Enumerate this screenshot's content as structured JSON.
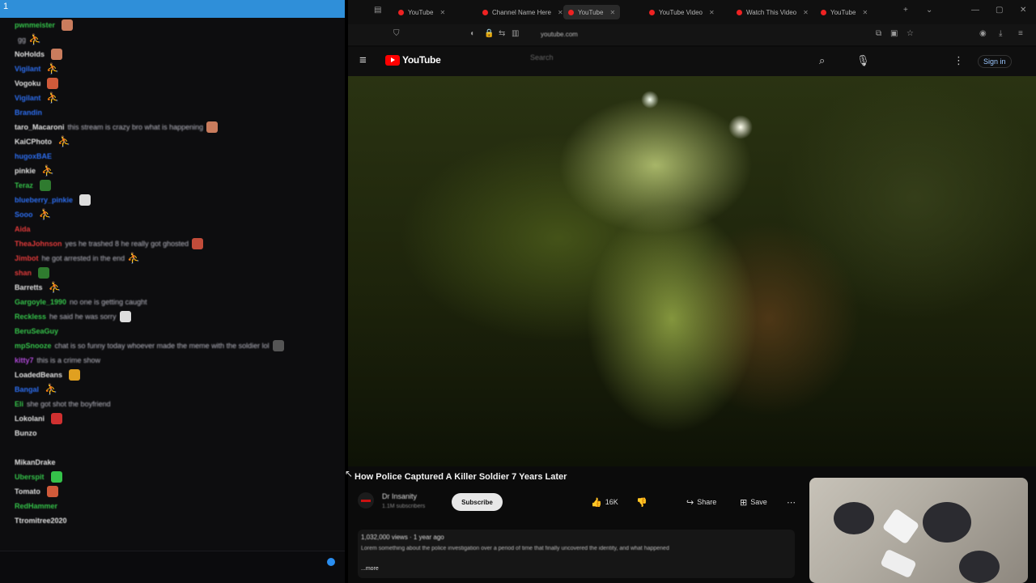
{
  "chat": {
    "top_mark": "1",
    "messages": [
      {
        "user": "pwnmeister",
        "color": "#35c24a",
        "text": "",
        "emote": "#c97c5d",
        "fig": false
      },
      {
        "user": "",
        "color": "#cccccc",
        "text": "gg",
        "emote": "",
        "fig": true
      },
      {
        "user": "NoHolds",
        "color": "#e0e0e0",
        "text": "",
        "emote": "#c97c5d",
        "fig": false
      },
      {
        "user": "Vigilant",
        "color": "#2d6ef0",
        "text": "",
        "emote": "",
        "fig": true
      },
      {
        "user": "Vogoku",
        "color": "#e0e0e0",
        "text": "",
        "emote": "#d05a3a",
        "fig": false
      },
      {
        "user": "Vigilant",
        "color": "#2d6ef0",
        "text": "",
        "emote": "",
        "fig": true
      },
      {
        "user": "Brandin",
        "color": "#2d6ef0",
        "text": "",
        "emote": "",
        "fig": false
      },
      {
        "user": "taro_Macaroni",
        "color": "#e0e0e0",
        "text": "this stream is crazy bro what is happening",
        "emote": "#c97c5d",
        "fig": false
      },
      {
        "user": "KaiCPhoto",
        "color": "#e0e0e0",
        "text": "",
        "emote": "",
        "fig": true
      },
      {
        "user": "hugoxBAE",
        "color": "#2d6ef0",
        "text": "",
        "emote": "",
        "fig": false
      },
      {
        "user": "pinkie",
        "color": "#e0e0e0",
        "text": "",
        "emote": "",
        "fig": true
      },
      {
        "user": "Teraz",
        "color": "#35c24a",
        "text": "",
        "emote": "#2f7b2f",
        "fig": false
      },
      {
        "user": "blueberry_pinkie",
        "color": "#2d6ef0",
        "text": "",
        "emote": "#dddddd",
        "fig": false
      },
      {
        "user": "Sooo",
        "color": "#2d6ef0",
        "text": "",
        "emote": "",
        "fig": true
      },
      {
        "user": "Aida",
        "color": "#e03a3a",
        "text": "",
        "emote": "",
        "fig": false
      },
      {
        "user": "TheaJohnson",
        "color": "#e03a3a",
        "text": "yes he trashed 8 he really got ghosted",
        "emote": "#c24c3a",
        "fig": false
      },
      {
        "user": "Jimbot",
        "color": "#e03a3a",
        "text": "he got arrested in the end",
        "emote": "",
        "fig": true
      },
      {
        "user": "shan",
        "color": "#e03a3a",
        "text": "",
        "emote": "#2f7b2f",
        "fig": false
      },
      {
        "user": "Barretts",
        "color": "#e0e0e0",
        "text": "",
        "emote": "",
        "fig": true
      },
      {
        "user": "Gargoyle_1990",
        "color": "#35c24a",
        "text": "no one is getting caught",
        "emote": "",
        "fig": false
      },
      {
        "user": "Reckless",
        "color": "#35c24a",
        "text": "he said he was sorry",
        "emote": "#dddddd",
        "fig": false
      },
      {
        "user": "BeruSeaGuy",
        "color": "#35c24a",
        "text": "",
        "emote": "",
        "fig": false
      },
      {
        "user": "mpSnooze",
        "color": "#35c24a",
        "text": "chat is so funny today whoever made the meme with the soldier lol",
        "emote": "#555555",
        "fig": false
      },
      {
        "user": "kitty7",
        "color": "#b04ad8",
        "text": "this is a crime show",
        "emote": "",
        "fig": false
      },
      {
        "user": "LoadedBeans",
        "color": "#e0e0e0",
        "text": "",
        "emote": "#e0a020",
        "fig": false
      },
      {
        "user": "Bangal",
        "color": "#2d6ef0",
        "text": "",
        "emote": "",
        "fig": true
      },
      {
        "user": "Eli",
        "color": "#35c24a",
        "text": "she got shot the boyfriend",
        "emote": "",
        "fig": false
      },
      {
        "user": "Lokolani",
        "color": "#e0e0e0",
        "text": "",
        "emote": "#d03030",
        "fig": false
      },
      {
        "user": "Bunzo",
        "color": "#e0e0e0",
        "text": "",
        "emote": "",
        "fig": false
      },
      {
        "user": "",
        "color": "#35c24a",
        "text": "",
        "emote": "",
        "fig": false
      },
      {
        "user": "MikanDrake",
        "color": "#e0e0e0",
        "text": "",
        "emote": "",
        "fig": false
      },
      {
        "user": "Uberspit",
        "color": "#35c24a",
        "text": "",
        "emote": "#35c24a",
        "fig": false
      },
      {
        "user": "Tomato",
        "color": "#e0e0e0",
        "text": "",
        "emote": "#d05a3a",
        "fig": false
      },
      {
        "user": "RedHammer",
        "color": "#35c24a",
        "text": "",
        "emote": "",
        "fig": false
      },
      {
        "user": "Ttromitree2020",
        "color": "#e0e0e0",
        "text": "",
        "emote": "",
        "fig": false
      }
    ]
  },
  "browser": {
    "tabs": [
      {
        "label": "YouTube",
        "active": false
      },
      {
        "label": "Channel Name Here",
        "active": false
      },
      {
        "label": "YouTube",
        "active": true
      },
      {
        "label": "YouTube Video",
        "active": false
      },
      {
        "label": "Watch This Video",
        "active": false
      },
      {
        "label": "YouTube",
        "active": false
      }
    ],
    "url": "youtube.com",
    "window_controls": [
      "—",
      "▢",
      "✕"
    ]
  },
  "youtube": {
    "logo_text": "YouTube",
    "search_placeholder": "Search",
    "signin_label": "Sign in",
    "video_title": "How Police Captured A Killer Soldier 7 Years Later",
    "channel_name": "Dr Insanity",
    "channel_subs": "1.1M subscribers",
    "subscribe_label": "Subscribe",
    "likes": "16K",
    "dislike_label": "",
    "share_label": "Share",
    "save_label": "Save",
    "desc_meta": "1,032,000 views · 1 year ago",
    "desc_text": "Lorem something about the police investigation over a period of time that finally uncovered the identity, and what happened",
    "desc_more": "...more"
  }
}
